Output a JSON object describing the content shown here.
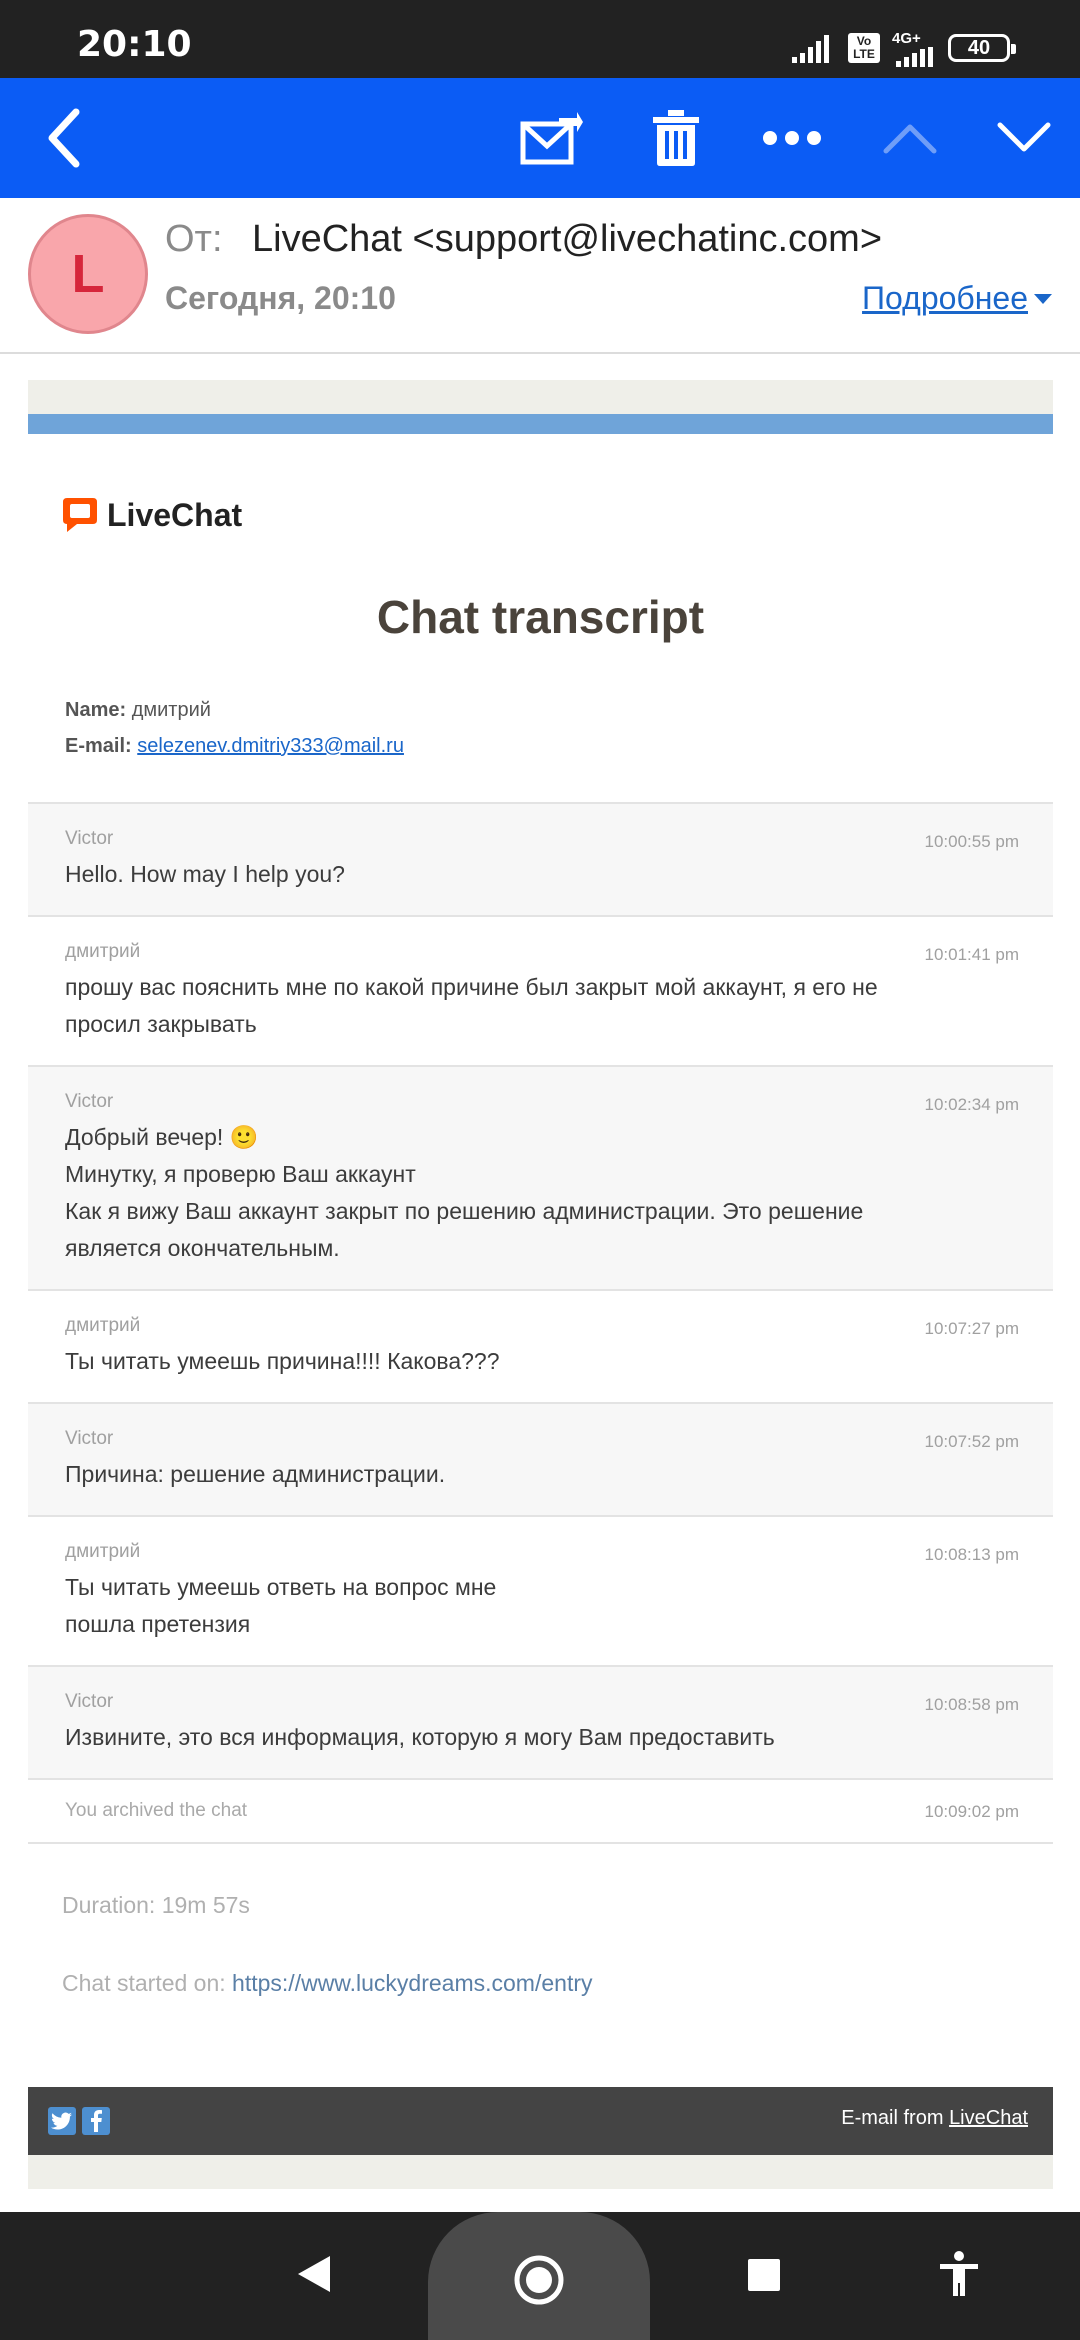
{
  "status_bar": {
    "time": "20:10",
    "network": "4G+",
    "volte": "Vo\nLTE",
    "battery": "40"
  },
  "toolbar": {
    "icons": [
      "back-arrow-icon",
      "mark-unread-icon",
      "trash-icon",
      "more-icon",
      "chevron-up-icon",
      "chevron-down-icon"
    ]
  },
  "header": {
    "avatar_letter": "L",
    "from_label": "От:",
    "from_value": "LiveChat <support@livechatinc.com>",
    "date": "Сегодня, 20:10",
    "details_link": "Подробнее"
  },
  "email": {
    "logo_text": "LiveChat",
    "title": "Chat transcript",
    "name_label": "Name:",
    "name_value": "дмитрий",
    "email_label": "E-mail:",
    "email_value": "selezenev.dmitriy333@mail.ru",
    "messages": [
      {
        "author": "Victor",
        "time": "10:00:55 pm",
        "lines": [
          "Hello. How may I help you?"
        ]
      },
      {
        "author": "дмитрий",
        "time": "10:01:41 pm",
        "lines": [
          "прошу вас пояснить мне по какой причине был закрыт мой аккаунт, я его не",
          "просил закрывать"
        ]
      },
      {
        "author": "Victor",
        "time": "10:02:34 pm",
        "lines": [
          "Добрый вечер! 🙂",
          "Минутку, я проверю Ваш аккаунт",
          "Как я вижу Ваш аккаунт закрыт по решению администрации. Это решение",
          "является окончательным."
        ]
      },
      {
        "author": "дмитрий",
        "time": "10:07:27 pm",
        "lines": [
          "Ты читать умеешь причина!!!! Какова???"
        ]
      },
      {
        "author": "Victor",
        "time": "10:07:52 pm",
        "lines": [
          "Причина: решение администрации."
        ]
      },
      {
        "author": "дмитрий",
        "time": "10:08:13 pm",
        "lines": [
          "Ты читать умеешь ответь на вопрос мне",
          "пошла претензия"
        ]
      },
      {
        "author": "Victor",
        "time": "10:08:58 pm",
        "lines": [
          "Извините, это вся информация, которую я могу Вам предоставить"
        ]
      }
    ],
    "system_event": {
      "text": "You archived the chat",
      "time": "10:09:02 pm"
    },
    "duration": "Duration: 19m 57s",
    "started_label": "Chat started on:",
    "started_url": "https://www.luckydreams.com/entry",
    "footer_text": "E-mail from",
    "footer_link": "LiveChat"
  }
}
